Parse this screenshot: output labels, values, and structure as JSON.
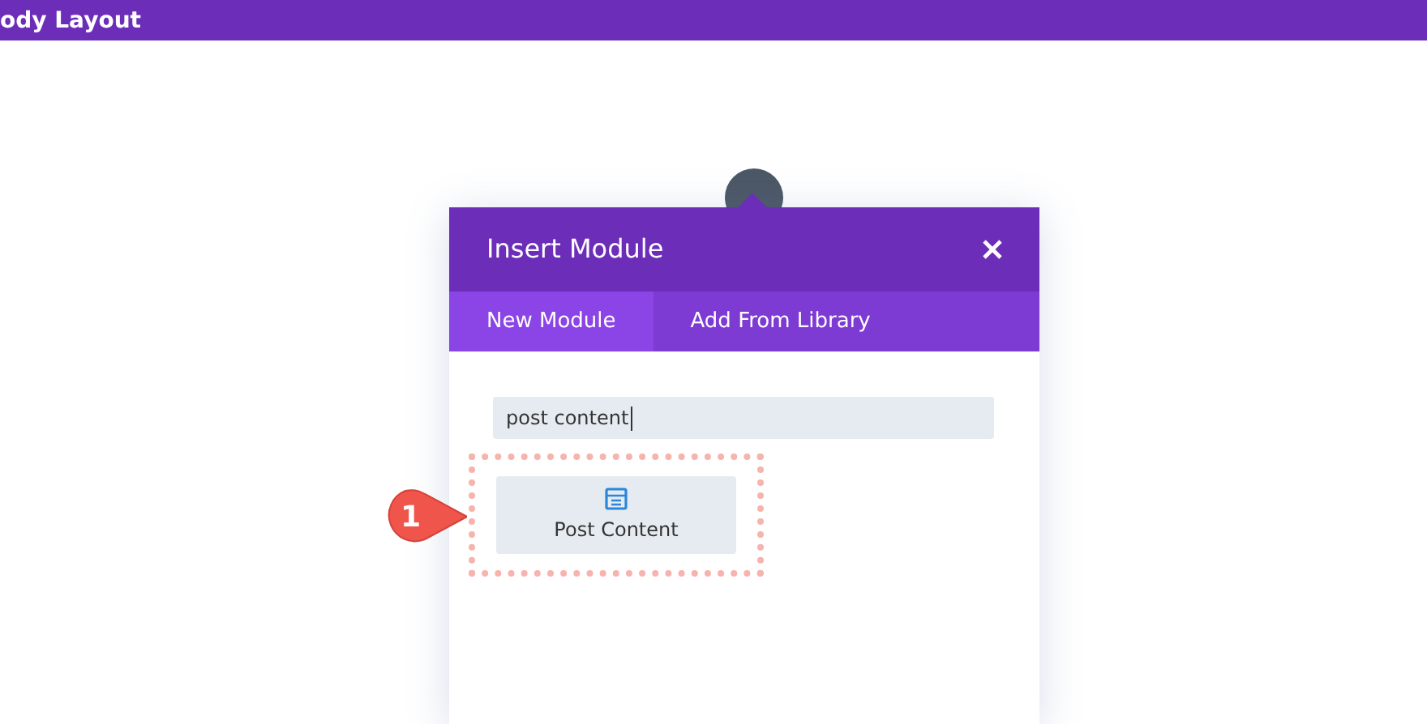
{
  "top_bar": {
    "title": "ody Layout"
  },
  "modal": {
    "title": "Insert Module",
    "tabs": [
      {
        "label": "New Module",
        "selected": true
      },
      {
        "label": "Add From Library",
        "selected": false
      }
    ],
    "search": {
      "value": "post content"
    },
    "results": [
      {
        "label": "Post Content",
        "highlighted": true
      }
    ]
  },
  "callout": {
    "number": "1"
  }
}
